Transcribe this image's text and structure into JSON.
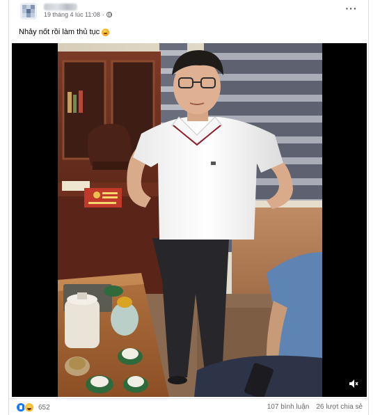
{
  "post": {
    "timestamp": "19 tháng 4 lúc 11:08",
    "caption": "Nhảy nốt rồi làm thủ tục",
    "privacy_icon": "globe-icon",
    "menu_icon": "more-dots-icon"
  },
  "video": {
    "mute_icon": "speaker-muted-icon"
  },
  "footer": {
    "reaction_icons": [
      "like-icon",
      "haha-icon"
    ],
    "reaction_count": "652",
    "comments": "107 bình luận",
    "shares": "26 lượt chia sẻ"
  },
  "colors": {
    "brand_blue": "#1877f2",
    "meta_text": "#65676b"
  }
}
